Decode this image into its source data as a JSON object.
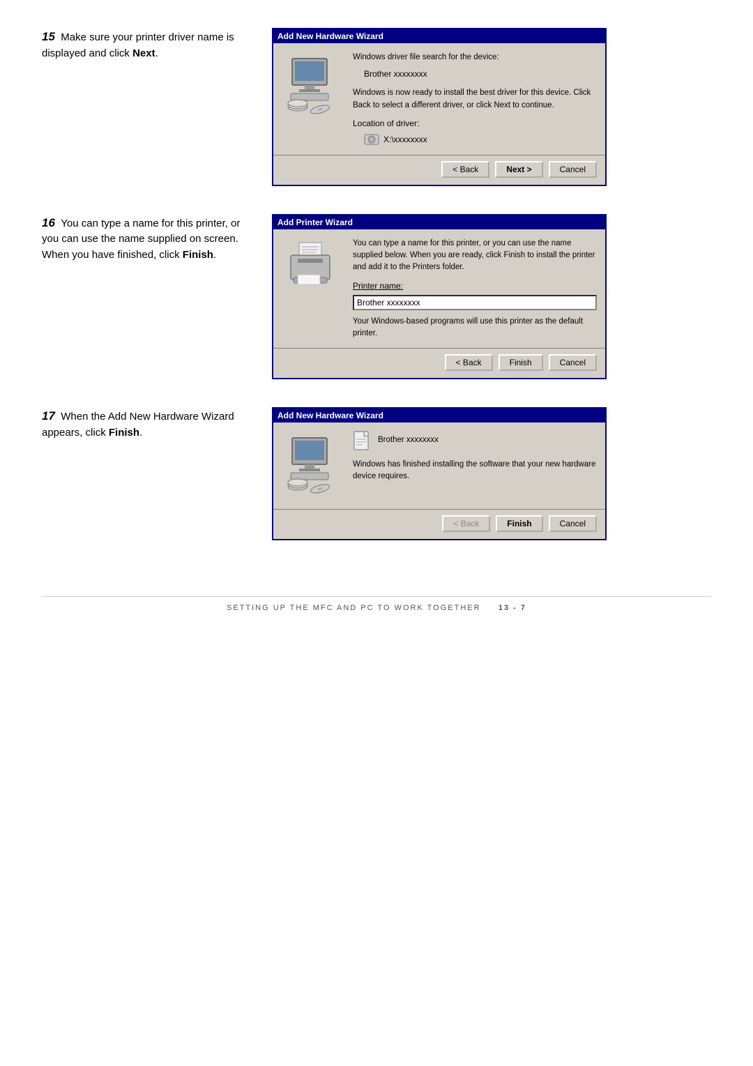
{
  "steps": [
    {
      "number": "15",
      "text_parts": [
        "Make sure your printer driver name is displayed and click ",
        "Next",
        "."
      ],
      "bold_word": "Next",
      "dialog": {
        "title": "Add New Hardware Wizard",
        "intro_text": "Windows driver file search for the device:",
        "driver_name": "Brother xxxxxxxx",
        "body_text": "Windows is now ready to install the best driver for this device. Click Back to select a different driver, or click Next to continue.",
        "location_label": "Location of driver:",
        "location_value": "X:\\xxxxxxxx",
        "buttons": [
          "< Back",
          "Next >",
          "Cancel"
        ],
        "default_button": "Next >"
      }
    },
    {
      "number": "16",
      "text_parts": [
        "You can type a name for this printer, or you can use the name supplied on screen. When you have finished, click ",
        "Finish",
        "."
      ],
      "bold_word": "Finish",
      "dialog": {
        "title": "Add Printer Wizard",
        "body_text": "You can type a name for this printer, or you can use the name supplied below. When you are ready, click Finish to install the printer and add it to the Printers folder.",
        "printer_label": "Printer name:",
        "printer_value": "Brother xxxxxxxx",
        "default_text": "Your Windows-based programs will use this printer as the default printer.",
        "buttons": [
          "< Back",
          "Finish",
          "Cancel"
        ],
        "default_button": "Finish"
      }
    },
    {
      "number": "17",
      "text_parts": [
        "When the Add New Hardware Wizard appears, click ",
        "Finish",
        "."
      ],
      "bold_word": "Finish",
      "dialog": {
        "title": "Add New Hardware Wizard",
        "driver_name": "Brother xxxxxxxx",
        "body_text": "Windows has finished installing the software that your new hardware device requires.",
        "buttons": [
          "< Back",
          "Finish",
          "Cancel"
        ],
        "default_button": "Finish"
      }
    }
  ],
  "footer": {
    "text": "SETTING UP THE MFC AND PC TO WORK TOGETHER",
    "page": "13 - 7"
  }
}
